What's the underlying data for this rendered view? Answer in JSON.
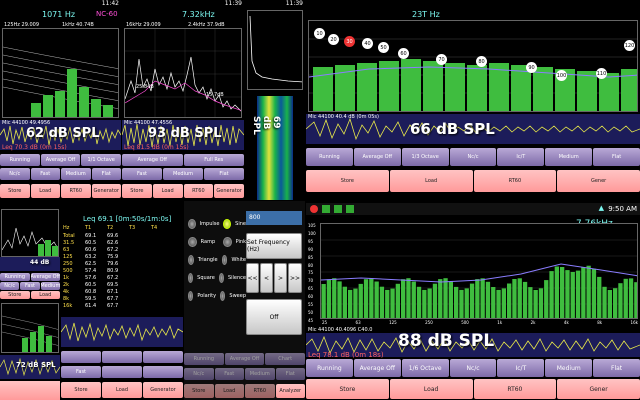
{
  "panel_a": {
    "time": "11:42",
    "freq": "1071 Hz",
    "nc": "NC-60",
    "sub_left": "125Hz 29.009",
    "sub_right": "1kHz 40.74B",
    "spl": "62 dB SPL",
    "info": "Mic 44100 49.4956",
    "leq": "Leq 70.3 dB (0m 15s)",
    "rows": [
      [
        "Running",
        "Average Off",
        "1/1 Octave"
      ],
      [
        "Nc/c",
        "Fast",
        "Medium",
        "Flat"
      ],
      [
        "Store",
        "Load",
        "RT60",
        "Generator"
      ]
    ]
  },
  "panel_b": {
    "time": "11:39",
    "freq": "7.32kHz",
    "sub_left": "16kHz 29.009",
    "sub_right": "2.4kHz 37.9dB",
    "peak_left": "25.84B",
    "peak_right": "15.7dB",
    "spl": "93 dB SPL",
    "info": "Mic 44100 47.4556",
    "leq": "Leq 81.5 dB (0m 15s)",
    "rows": [
      [
        "Average Off",
        "Full Res"
      ],
      [
        "Fast",
        "Medium",
        "Flat"
      ],
      [
        "Store",
        "Load",
        "RT60",
        "Generator"
      ]
    ]
  },
  "panel_c": {
    "time": "11:39",
    "spl": "69 dB SPL"
  },
  "panel_d": {
    "freq": "23T Hz",
    "info": "Mic 44100 40.4 dB (0m 05s)",
    "spl": "66 dB SPL",
    "markers": [
      "10",
      "20",
      "30",
      "40",
      "50",
      "60",
      "70",
      "80",
      "90",
      "100",
      "110",
      "120"
    ],
    "rows": [
      [
        "Running",
        "Average Off",
        "1/3 Octave",
        "Nc/c",
        "Ic/T",
        "Medium",
        "Flat"
      ],
      [
        "Store",
        "Load",
        "RT60",
        "Gener"
      ]
    ]
  },
  "panel_e": {
    "spl": "44 dB",
    "rows": [
      [
        "Running",
        "Average Off"
      ],
      [
        "Nc/c",
        "Fast",
        "Medium"
      ],
      [
        "Store",
        "Load"
      ]
    ]
  },
  "panel_f": {
    "spl": "72 dB SPL"
  },
  "panel_g": {
    "leq": "Leq 69.1 [0m:50s/1m:0s]",
    "headers": [
      "Hz",
      "T1",
      "T2",
      "T3",
      "T4"
    ],
    "table": [
      [
        "Total",
        "69.1",
        "69.6"
      ],
      [
        "31.5",
        "60.5",
        "62.6"
      ],
      [
        "63",
        "60.6",
        "67.2"
      ],
      [
        "125",
        "63.2",
        "75.9"
      ],
      [
        "250",
        "62.5",
        "79.6"
      ],
      [
        "500",
        "57.4",
        "80.9"
      ],
      [
        "1k",
        "57.6",
        "67.2"
      ],
      [
        "2k",
        "60.5",
        "69.5"
      ],
      [
        "4k",
        "60.8",
        "67.1"
      ],
      [
        "8k",
        "59.5",
        "67.7"
      ],
      [
        "16k",
        "61.4",
        "67.7"
      ]
    ],
    "rows": [
      [
        "",
        "",
        ""
      ],
      [
        "Fast",
        "",
        ""
      ],
      [
        "Store",
        "Load",
        "Generator"
      ]
    ]
  },
  "panel_h": {
    "signals": [
      [
        "Impulse",
        "Sine"
      ],
      [
        "Ramp",
        "Pink"
      ],
      [
        "Triangle",
        "White"
      ],
      [
        "Square",
        "Silence"
      ],
      [
        "Polarity",
        "Sweep"
      ]
    ],
    "value": "800",
    "set_freq": "Set Frequency (Hz)",
    "arrows": [
      "<<",
      "<",
      ">",
      ">>"
    ],
    "off": "Off",
    "rows": [
      [
        "Running",
        "Average Off",
        "Chart"
      ],
      [
        "Nc/c",
        "Fast",
        "Medium",
        "Flat"
      ],
      [
        "Store",
        "Load",
        "RT60",
        "Analyzer"
      ]
    ]
  },
  "panel_i": {
    "time": "9:50 AM",
    "freq": "7.76kHz",
    "y_ticks": [
      "105",
      "100",
      "95",
      "90",
      "85",
      "80",
      "75",
      "70",
      "65",
      "60",
      "55",
      "50",
      "45"
    ],
    "x_ticks": [
      "25",
      "63",
      "125",
      "250",
      "500",
      "1k",
      "2k",
      "4k",
      "8k",
      "16k"
    ],
    "info": "Mic 44100 40.4096 C40.0",
    "spl": "88 dB SPL",
    "leq": "Leq 78.1 dB (0m 18s)",
    "rows": [
      [
        "Running",
        "Average Off",
        "1/6 Octave",
        "Nc/c",
        "Ic/T",
        "Medium",
        "Flat"
      ],
      [
        "Store",
        "Load",
        "RT60",
        "Gener"
      ]
    ]
  },
  "colors": {
    "bar_green": "#3fbd3f",
    "spl_text": "#ffffff",
    "leq_red": "#ff6161",
    "button_purple": "#9d8cc4",
    "button_pink": "#ff9a9a",
    "wave_bg": "#1c1c5a",
    "freq_cyan": "#7cf7f0"
  }
}
